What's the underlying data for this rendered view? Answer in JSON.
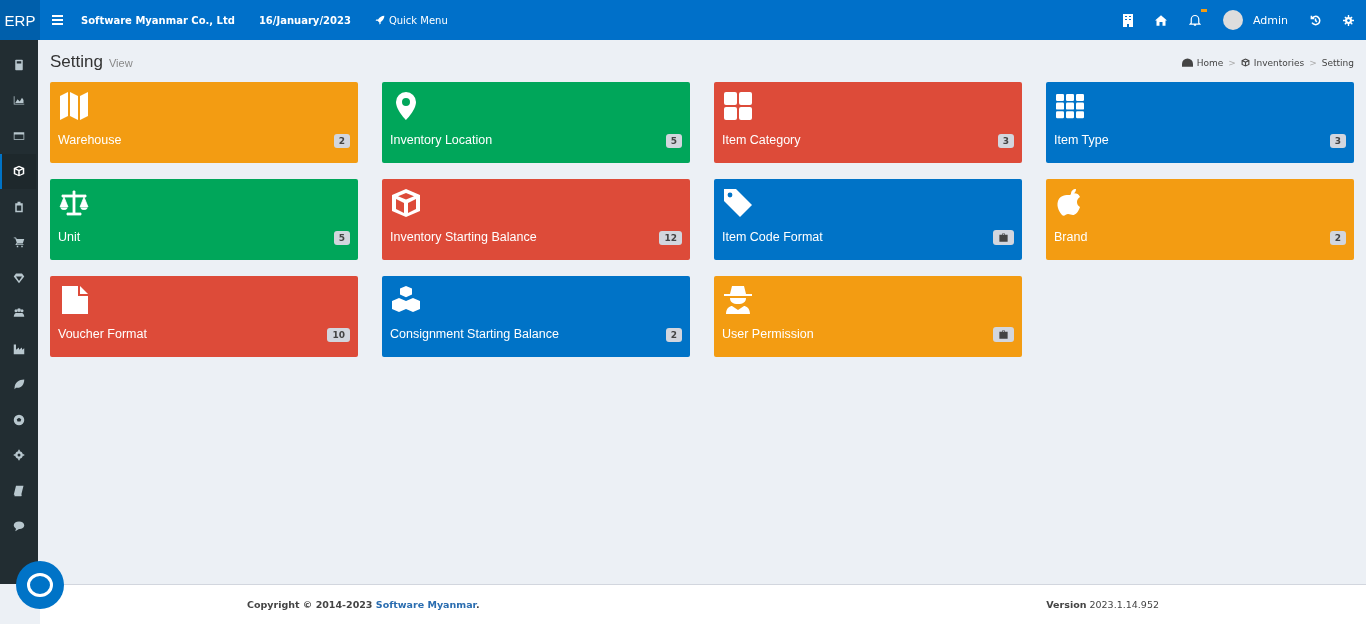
{
  "brand": "ERP",
  "topbar": {
    "company": "Software Myanmar Co., Ltd",
    "date": "16/January/2023",
    "quick_menu": "Quick Menu",
    "user": "Admin",
    "notification_dot": true
  },
  "sidebar": {
    "items": [
      {
        "selected": false
      },
      {
        "selected": false
      },
      {
        "selected": false
      },
      {
        "selected": true
      },
      {
        "selected": false
      },
      {
        "selected": false
      },
      {
        "selected": false
      },
      {
        "selected": false
      },
      {
        "selected": false
      },
      {
        "selected": false
      },
      {
        "selected": false
      },
      {
        "selected": false
      },
      {
        "selected": false
      },
      {
        "selected": false
      }
    ]
  },
  "page": {
    "title": "Setting",
    "subtitle": "View",
    "breadcrumb": [
      "Home",
      "Inventories",
      "Setting"
    ],
    "breadcrumb_separators": [
      ">",
      ">"
    ]
  },
  "tiles": [
    {
      "label": "Warehouse",
      "color": "#f39c12",
      "badge": {
        "kind": "count",
        "text": "2"
      }
    },
    {
      "label": "Inventory Location",
      "color": "#00a65a",
      "badge": {
        "kind": "count",
        "text": "5"
      }
    },
    {
      "label": "Item Category",
      "color": "#dd4b39",
      "badge": {
        "kind": "count",
        "text": "3"
      }
    },
    {
      "label": "Item Type",
      "color": "#0073c7",
      "badge": {
        "kind": "count",
        "text": "3"
      }
    },
    {
      "label": "Unit",
      "color": "#00a65a",
      "badge": {
        "kind": "count",
        "text": "5"
      }
    },
    {
      "label": "Inventory Starting Balance",
      "color": "#dd4b39",
      "badge": {
        "kind": "count",
        "text": "12"
      }
    },
    {
      "label": "Item Code Format",
      "color": "#0073c7",
      "badge": {
        "kind": "briefcase"
      }
    },
    {
      "label": "Brand",
      "color": "#f39c12",
      "badge": {
        "kind": "count",
        "text": "2"
      }
    },
    {
      "label": "Voucher Format",
      "color": "#dd4b39",
      "badge": {
        "kind": "count",
        "text": "10"
      }
    },
    {
      "label": "Consignment Starting Balance",
      "color": "#0073c7",
      "badge": {
        "kind": "count",
        "text": "2"
      }
    },
    {
      "label": "User Permission",
      "color": "#f39c12",
      "badge": {
        "kind": "briefcase"
      }
    }
  ],
  "footer": {
    "copyright": "Copyright © 2014-2023",
    "company_link": "Software Myanmar",
    "period": ".",
    "version_label": "Version",
    "version": "2023.1.14.952"
  }
}
